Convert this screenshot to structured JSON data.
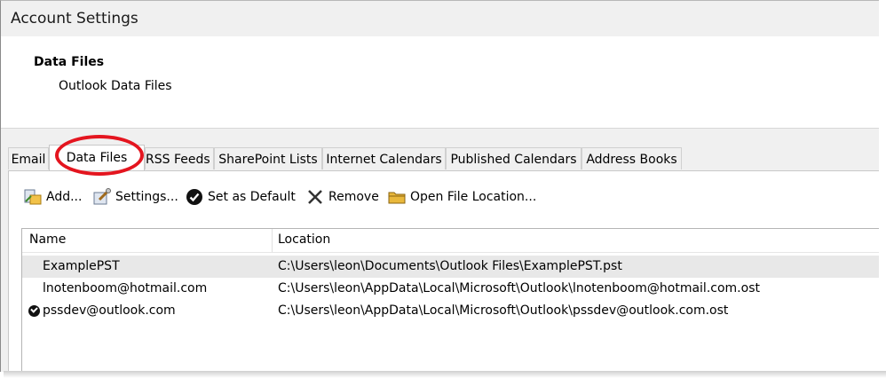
{
  "window": {
    "title": "Account Settings"
  },
  "header": {
    "title": "Data Files",
    "subtitle": "Outlook Data Files"
  },
  "tabs": [
    {
      "label": "Email"
    },
    {
      "label": "Data Files"
    },
    {
      "label": "RSS Feeds"
    },
    {
      "label": "SharePoint Lists"
    },
    {
      "label": "Internet Calendars"
    },
    {
      "label": "Published Calendars"
    },
    {
      "label": "Address Books"
    }
  ],
  "toolbar": {
    "add": "Add...",
    "settings": "Settings...",
    "set_default": "Set as Default",
    "remove": "Remove",
    "open_location": "Open File Location..."
  },
  "list": {
    "columns": {
      "name": "Name",
      "location": "Location"
    },
    "rows": [
      {
        "name": "ExamplePST",
        "location": "C:\\Users\\leon\\Documents\\Outlook Files\\ExamplePST.pst",
        "default": false
      },
      {
        "name": "lnotenboom@hotmail.com",
        "location": "C:\\Users\\leon\\AppData\\Local\\Microsoft\\Outlook\\lnotenboom@hotmail.com.ost",
        "default": false
      },
      {
        "name": "pssdev@outlook.com",
        "location": "C:\\Users\\leon\\AppData\\Local\\Microsoft\\Outlook\\pssdev@outlook.com.ost",
        "default": true
      }
    ]
  },
  "colors": {
    "highlight_circle": "#e4151f",
    "selected_row": "#e8e8e8"
  }
}
